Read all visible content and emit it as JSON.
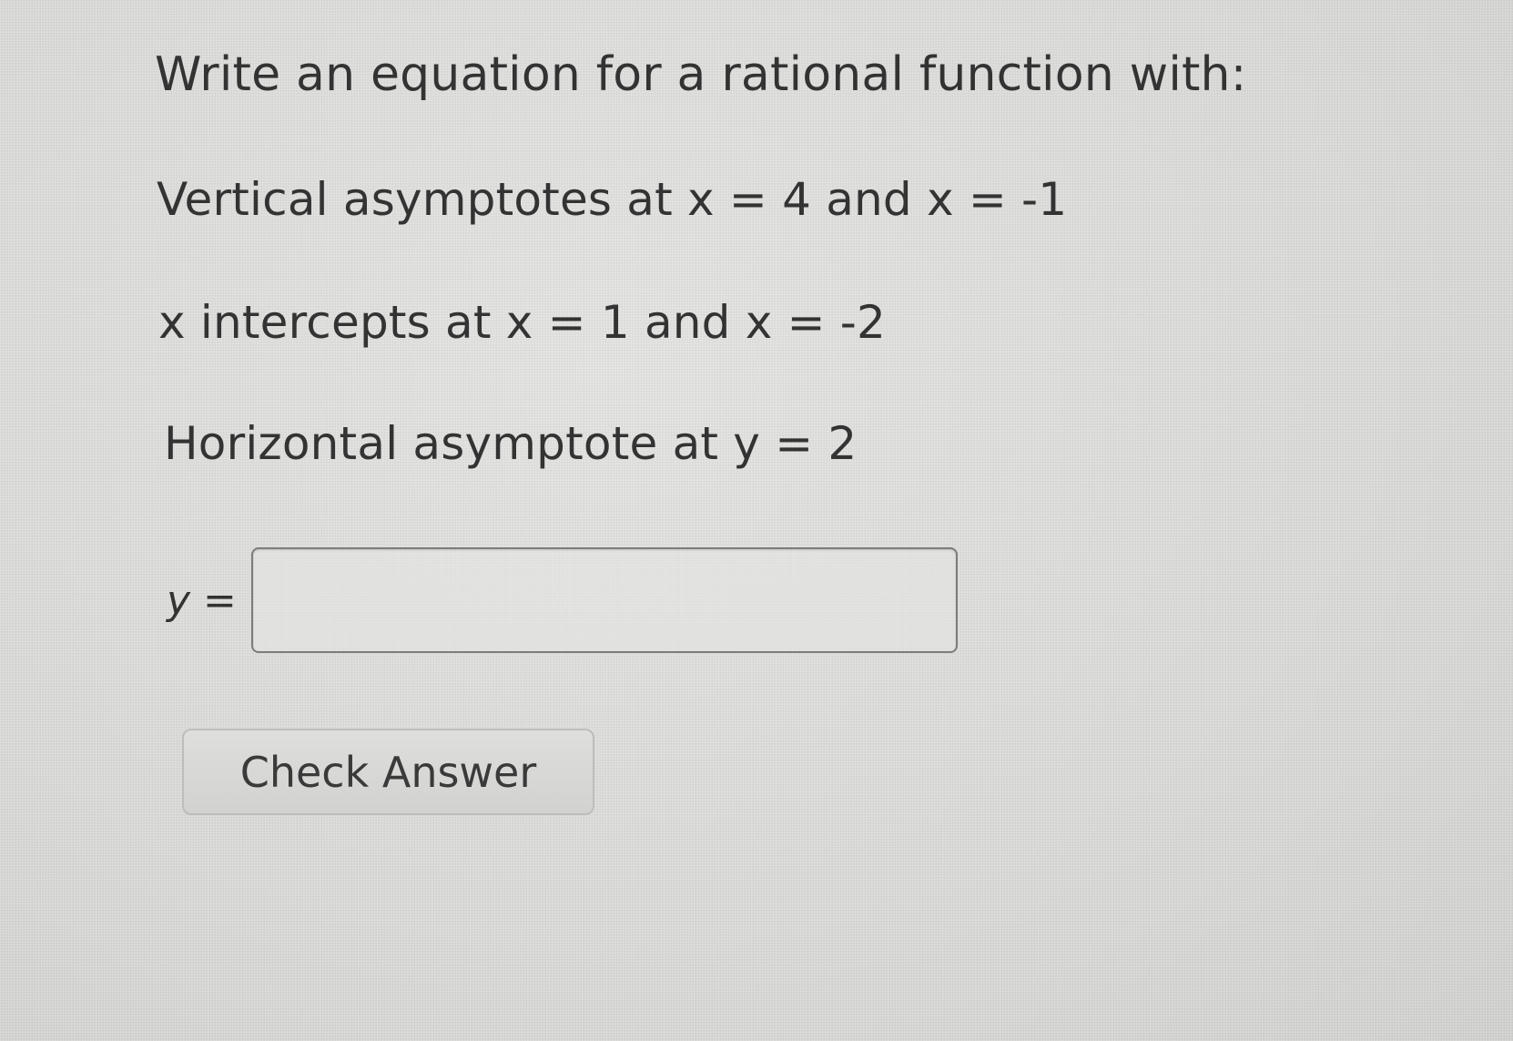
{
  "question": {
    "prompt": "Write an equation for a rational function with:",
    "conditions": [
      "Vertical asymptotes at x = 4 and x = -1",
      "x intercepts at x = 1 and x = -2",
      "Horizontal asymptote at y = 2"
    ]
  },
  "answer": {
    "label": "y =",
    "value": ""
  },
  "actions": {
    "check_label": "Check Answer"
  }
}
